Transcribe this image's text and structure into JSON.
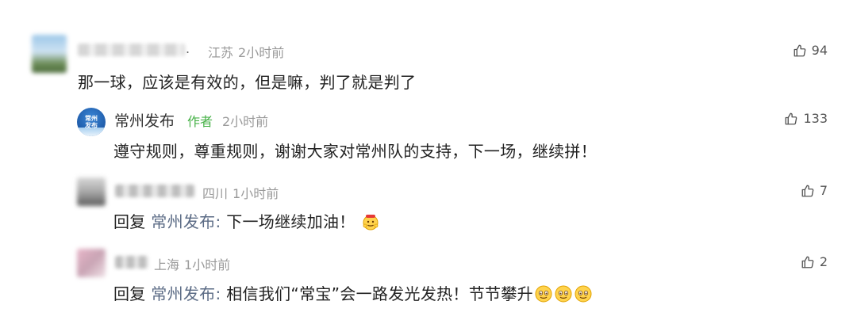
{
  "comments": [
    {
      "location": "江苏",
      "time": "2小时前",
      "name_tail": ".",
      "content": "那一球，应该是有效的，但是嘛，判了就是判了",
      "likes": "94"
    }
  ],
  "replies": [
    {
      "name": "常州发布",
      "author_tag": "作者",
      "time": "2小时前",
      "avatar_text_top": "常州",
      "avatar_text_bottom": "发布",
      "content": "遵守规则，尊重规则，谢谢大家对常州队的支持，下一场，继续拼！",
      "likes": "133"
    },
    {
      "location": "四川",
      "time": "1小时前",
      "reply_prefix": "回复",
      "reply_target": "常州发布:",
      "content": "下一场继续加油！",
      "likes": "7"
    },
    {
      "location": "上海",
      "time": "1小时前",
      "reply_prefix": "回复",
      "reply_target": "常州发布:",
      "content": "相信我们“常宝”会一路发光发热！节节攀升",
      "likes": "2"
    }
  ],
  "icons": {
    "like": "thumbs-up-icon",
    "emoji_cheer": "cheering-emoji-icon",
    "emoji_smile": "smiling-emoji-icon"
  },
  "colors": {
    "author_tag": "#46b147",
    "reply_target": "#5b6b85",
    "meta": "#9a9a9a"
  }
}
